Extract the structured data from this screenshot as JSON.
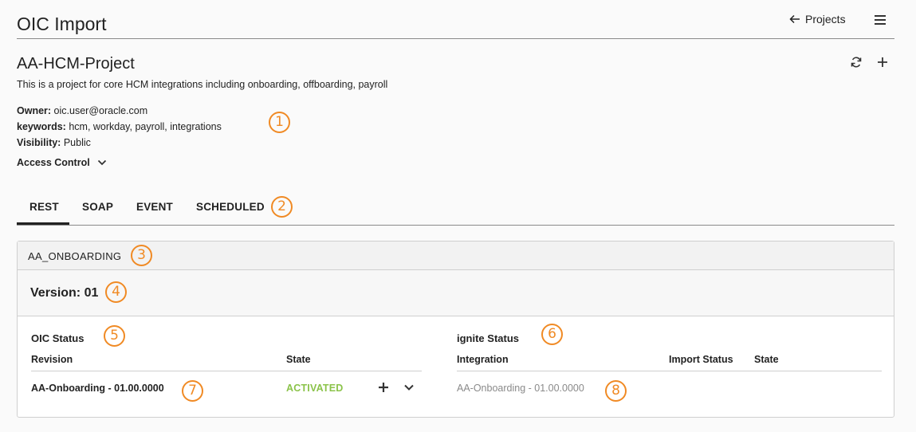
{
  "header": {
    "title": "OIC Import",
    "projects_link": "Projects",
    "icons": {
      "back": "arrow-left-icon",
      "menu": "hamburger-menu-icon"
    }
  },
  "project": {
    "title": "AA-HCM-Project",
    "description": "This is a project for core HCM integrations including onboarding, offboarding, payroll",
    "owner_label": "Owner:",
    "owner_value": "oic.user@oracle.com",
    "keywords_label": "keywords:",
    "keywords_value": "hcm, workday, payroll, integrations",
    "visibility_label": "Visibility:",
    "visibility_value": "Public",
    "access_control_label": "Access Control",
    "icons": {
      "refresh": "refresh-icon",
      "add": "plus-icon",
      "expand": "chevron-down-icon"
    }
  },
  "tabs": [
    {
      "label": "REST",
      "active": true
    },
    {
      "label": "SOAP",
      "active": false
    },
    {
      "label": "EVENT",
      "active": false
    },
    {
      "label": "SCHEDULED",
      "active": false
    }
  ],
  "integration_panel": {
    "name": "AA_ONBOARDING",
    "version_label": "Version: 01",
    "oic_status": {
      "title": "OIC Status",
      "columns": [
        "Revision",
        "State"
      ],
      "rows": [
        {
          "revision": "AA-Onboarding - 01.00.0000",
          "state": "ACTIVATED"
        }
      ]
    },
    "ignite_status": {
      "title": "ignite Status",
      "columns": [
        "Integration",
        "Import Status",
        "State"
      ],
      "rows": [
        {
          "integration": "AA-Onboarding - 01.00.0000",
          "import_status": "",
          "state": ""
        }
      ]
    }
  },
  "callouts": [
    "1",
    "2",
    "3",
    "4",
    "5",
    "6",
    "7",
    "8"
  ],
  "colors": {
    "callout": "#f08a24",
    "activated": "#8bc34a",
    "muted_text": "#8a8a8a",
    "background": "#fafafa"
  }
}
